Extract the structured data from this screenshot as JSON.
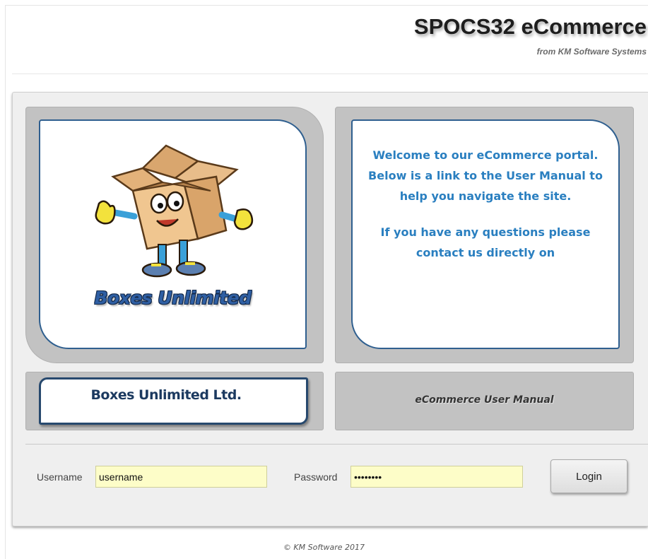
{
  "header": {
    "title": "SPOCS32 eCommerce",
    "subtitle": "from KM Software Systems"
  },
  "logo": {
    "name": "Boxes Unlimited",
    "mascot_icon": "cardboard-box-mascot-icon"
  },
  "welcome": {
    "paragraph1": "Welcome to our eCommerce portal. Below is a link to the User Manual to help you navigate the site.",
    "paragraph2": "If you have any questions please contact us directly on"
  },
  "company": {
    "name": "Boxes Unlimited Ltd."
  },
  "manual": {
    "link_label": "eCommerce User Manual"
  },
  "login": {
    "username_label": "Username",
    "username_value": "username",
    "password_label": "Password",
    "password_value": "password",
    "button_label": "Login"
  },
  "footer": {
    "copyright": "© KM Software 2017"
  },
  "colors": {
    "accent_blue": "#2a7fc0",
    "border_navy": "#2f5f8f",
    "input_yellow": "#fdfdc8",
    "panel_gray": "#c2c2c2"
  }
}
